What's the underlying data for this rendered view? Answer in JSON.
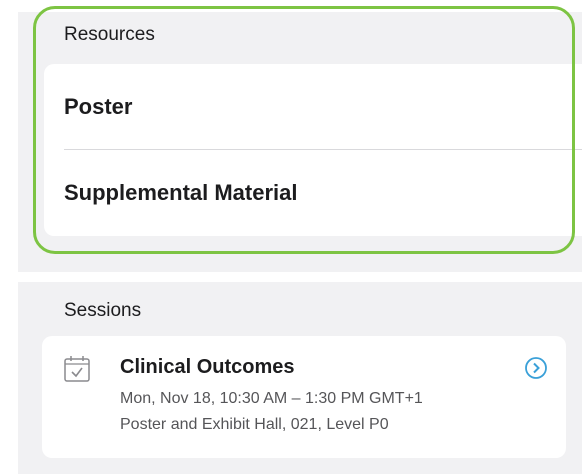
{
  "resources": {
    "section_label": "Resources",
    "items": [
      {
        "label": "Poster"
      },
      {
        "label": "Supplemental Material"
      }
    ]
  },
  "sessions": {
    "section_label": "Sessions",
    "items": [
      {
        "title": "Clinical Outcomes",
        "time": "Mon, Nov 18, 10:30 AM – 1:30 PM GMT+1",
        "location": "Poster and Exhibit Hall, 021, Level P0",
        "icon": "calendar-check-icon",
        "action_icon": "chevron-right-circle-icon"
      }
    ]
  },
  "colors": {
    "highlight_border": "#7dc443",
    "accent": "#3aa0d8",
    "panel_background": "#f1f1f3",
    "card_background": "#ffffff"
  }
}
